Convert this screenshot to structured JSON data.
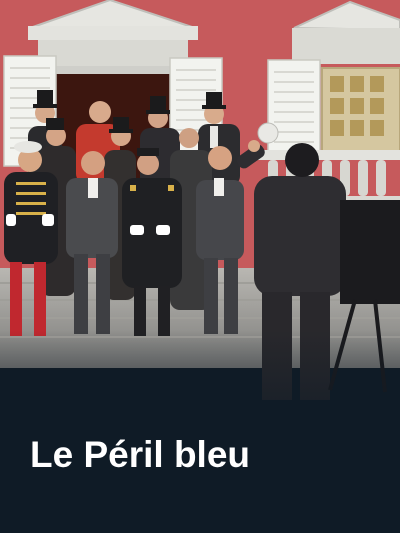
{
  "program": {
    "title": "Le Péril bleu"
  },
  "theme": {
    "background": "#0f1b26",
    "title_color": "#ffffff",
    "building_wall": "#c65a5c"
  },
  "poster_image": {
    "kind": "photo"
  }
}
